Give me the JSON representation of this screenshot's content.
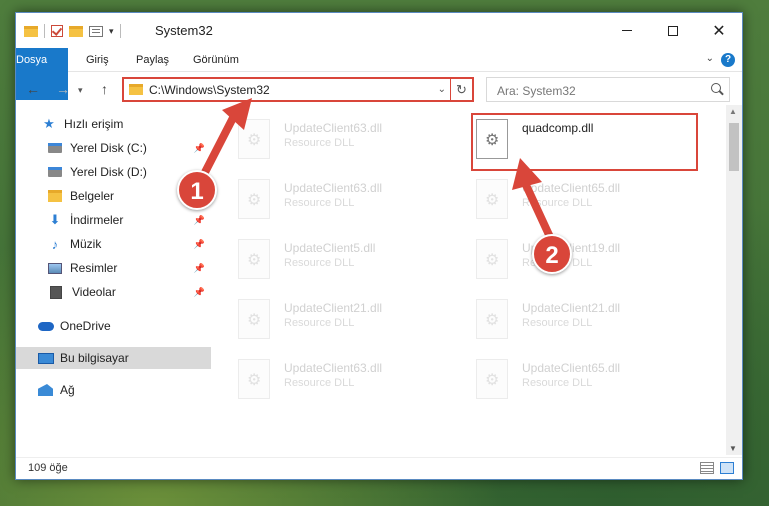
{
  "window": {
    "title": "System32",
    "controls": {
      "minimize": "minimize",
      "maximize": "maximize",
      "close": "✕"
    }
  },
  "ribbon": {
    "tabs": [
      {
        "label": "Dosya"
      },
      {
        "label": "Giriş"
      },
      {
        "label": "Paylaş"
      },
      {
        "label": "Görünüm"
      }
    ],
    "help": "?"
  },
  "navbar": {
    "path": "C:\\Windows\\System32",
    "search_placeholder": "Ara: System32"
  },
  "sidebar": {
    "items": [
      {
        "label": "Hızlı erişim"
      },
      {
        "label": "Yerel Disk (C:)"
      },
      {
        "label": "Yerel Disk (D:)"
      },
      {
        "label": "Belgeler"
      },
      {
        "label": "İndirmeler"
      },
      {
        "label": "Müzik"
      },
      {
        "label": "Resimler"
      },
      {
        "label": "Videolar"
      },
      {
        "label": "OneDrive"
      },
      {
        "label": "Bu bilgisayar"
      },
      {
        "label": "Ağ"
      }
    ]
  },
  "files": [
    {
      "name": "UpdateClient63.dll",
      "type": "Resource DLL"
    },
    {
      "name": "quadcomp.dll",
      "type": ""
    },
    {
      "name": "UpdateClient63.dll",
      "type": "Resource DLL"
    },
    {
      "name": "UpdateClient65.dll",
      "type": "Resource DLL"
    },
    {
      "name": "UpdateClient5.dll",
      "type": "Resource DLL"
    },
    {
      "name": "UpdateClient19.dll",
      "type": "Resource DLL"
    },
    {
      "name": "UpdateClient21.dll",
      "type": "Resource DLL"
    },
    {
      "name": "UpdateClient21.dll",
      "type": "Resource DLL"
    },
    {
      "name": "UpdateClient63.dll",
      "type": "Resource DLL"
    },
    {
      "name": "UpdateClient65.dll",
      "type": "Resource DLL"
    }
  ],
  "status": {
    "count": "109 öğe"
  },
  "markers": {
    "one": "1",
    "two": "2"
  },
  "colors": {
    "accent": "#1979ca",
    "highlight": "#d9463a"
  }
}
